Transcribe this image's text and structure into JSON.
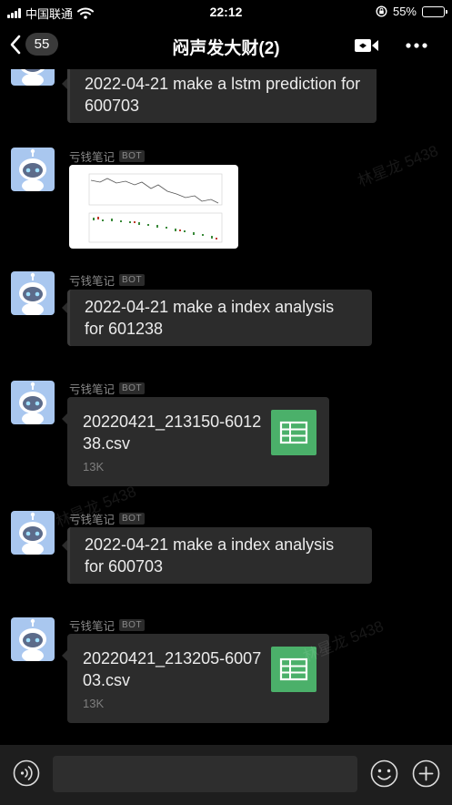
{
  "status_bar": {
    "carrier": "中国联通",
    "time": "22:12",
    "battery": "55%",
    "battery_level": 0.55,
    "icons": [
      "signal-icon",
      "wifi-icon",
      "orientation-lock-icon",
      "battery-icon"
    ]
  },
  "header": {
    "back_count": "55",
    "title": "闷声发大财(2)",
    "icons": [
      "back-chevron-icon",
      "video-call-icon",
      "more-icon"
    ]
  },
  "messages": [
    {
      "type": "text",
      "text": "2022-04-21 make a lstm prediction for 600703"
    },
    {
      "type": "image",
      "sender": "亏钱笔记",
      "badge": "BOT"
    },
    {
      "type": "text",
      "sender": "亏钱笔记",
      "badge": "BOT",
      "text": "2022-04-21 make a index analysis for 601238"
    },
    {
      "type": "file",
      "sender": "亏钱笔记",
      "badge": "BOT",
      "filename": "20220421_213150-601238.csv",
      "size": "13K",
      "icon": "spreadsheet-icon"
    },
    {
      "type": "text",
      "sender": "亏钱笔记",
      "badge": "BOT",
      "text": "2022-04-21 make a index analysis for 600703"
    },
    {
      "type": "file",
      "sender": "亏钱笔记",
      "badge": "BOT",
      "filename": "20220421_213205-600703.csv",
      "size": "13K",
      "icon": "spreadsheet-icon"
    }
  ],
  "watermark": "林星龙 5438",
  "input_bar": {
    "placeholder": "",
    "icons": [
      "voice-icon",
      "emoji-icon",
      "plus-icon"
    ]
  },
  "colors": {
    "background": "#000000",
    "bubble": "#2c2c2c",
    "file_icon": "#4bb06a",
    "avatar": "#a9c7ef"
  }
}
